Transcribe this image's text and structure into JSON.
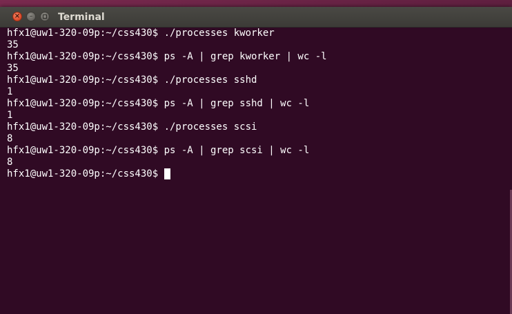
{
  "window": {
    "title": "Terminal",
    "close_glyph": "×",
    "minimize_glyph": "–"
  },
  "terminal": {
    "lines": [
      "hfx1@uw1-320-09p:~/css430$ ./processes kworker",
      "35",
      "hfx1@uw1-320-09p:~/css430$ ps -A | grep kworker | wc -l",
      "35",
      "hfx1@uw1-320-09p:~/css430$ ./processes sshd",
      "1",
      "hfx1@uw1-320-09p:~/css430$ ps -A | grep sshd | wc -l",
      "1",
      "hfx1@uw1-320-09p:~/css430$ ./processes scsi",
      "8",
      "hfx1@uw1-320-09p:~/css430$ ps -A | grep scsi | wc -l",
      "8"
    ],
    "prompt": "hfx1@uw1-320-09p:~/css430$ "
  },
  "colors": {
    "terminal_bg": "#300a24",
    "text": "#ffffff",
    "titlebar": "#3c3b37",
    "close_button": "#e14e2e"
  }
}
